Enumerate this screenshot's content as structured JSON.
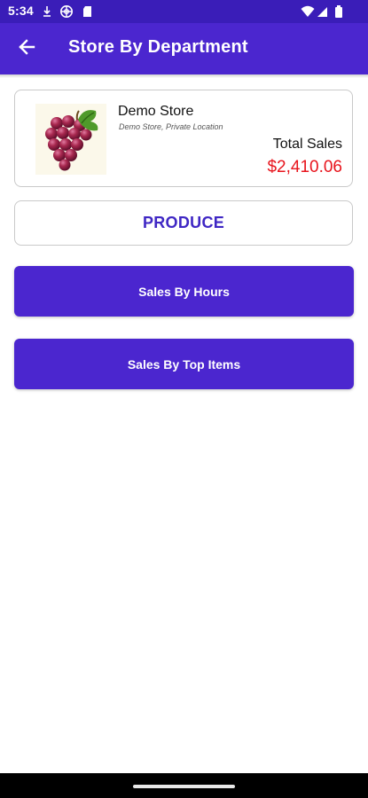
{
  "status_bar": {
    "time": "5:34",
    "icons": [
      "download-icon",
      "globe-icon",
      "sd-card-icon",
      "wifi-icon",
      "signal-icon",
      "battery-icon"
    ]
  },
  "app_bar": {
    "title": "Store By Department",
    "back_icon": "arrow-left-icon"
  },
  "store": {
    "name": "Demo Store",
    "subtitle": "Demo Store, Private Location",
    "image": "grapes-image",
    "total_sales_label": "Total Sales",
    "total_sales_value": "$2,410.06"
  },
  "department": {
    "name": "PRODUCE"
  },
  "buttons": {
    "sales_by_hours": "Sales By Hours",
    "sales_by_top_items": "Sales By Top Items"
  },
  "colors": {
    "status_bar": "#3a1db8",
    "primary": "#4b26cf",
    "department_text": "#3f27c4",
    "total_sales": "#e8141c"
  }
}
